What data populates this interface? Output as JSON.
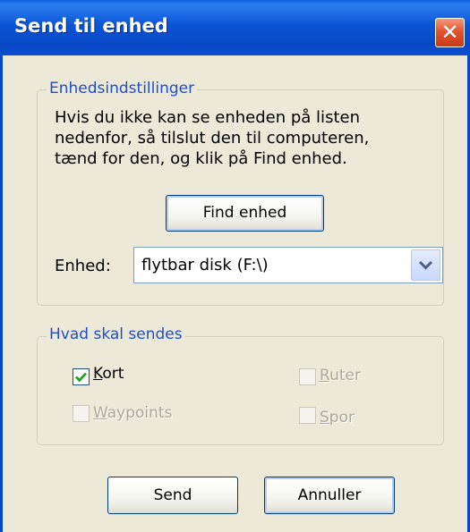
{
  "window": {
    "title": "Send til enhed",
    "close_symbol": "✕"
  },
  "device_settings": {
    "legend": "Enhedsindstillinger",
    "description_lines": [
      "Hvis du ikke kan se enheden på listen",
      "nedenfor, så tilslut den til computeren,",
      "tænd for den, og klik på Find enhed."
    ],
    "find_button": "Find enhed",
    "device_label": "Enhed:",
    "device_value": "flytbar disk (F:\\)"
  },
  "what_to_send": {
    "legend": "Hvad skal sendes",
    "options": [
      {
        "key": "K",
        "rest": "ort",
        "checked": true,
        "enabled": true
      },
      {
        "key": "R",
        "rest": "uter",
        "checked": false,
        "enabled": false
      },
      {
        "key": "W",
        "rest": "aypoints",
        "checked": false,
        "enabled": false
      },
      {
        "key": "S",
        "rest": "por",
        "checked": false,
        "enabled": false
      }
    ]
  },
  "buttons": {
    "send": "Send",
    "cancel": "Annuller"
  },
  "colors": {
    "titlebar": "#0a55d6",
    "group_legend": "#1f4ec5",
    "dialog_bg": "#ece9d8",
    "disabled_text": "#aca899"
  }
}
